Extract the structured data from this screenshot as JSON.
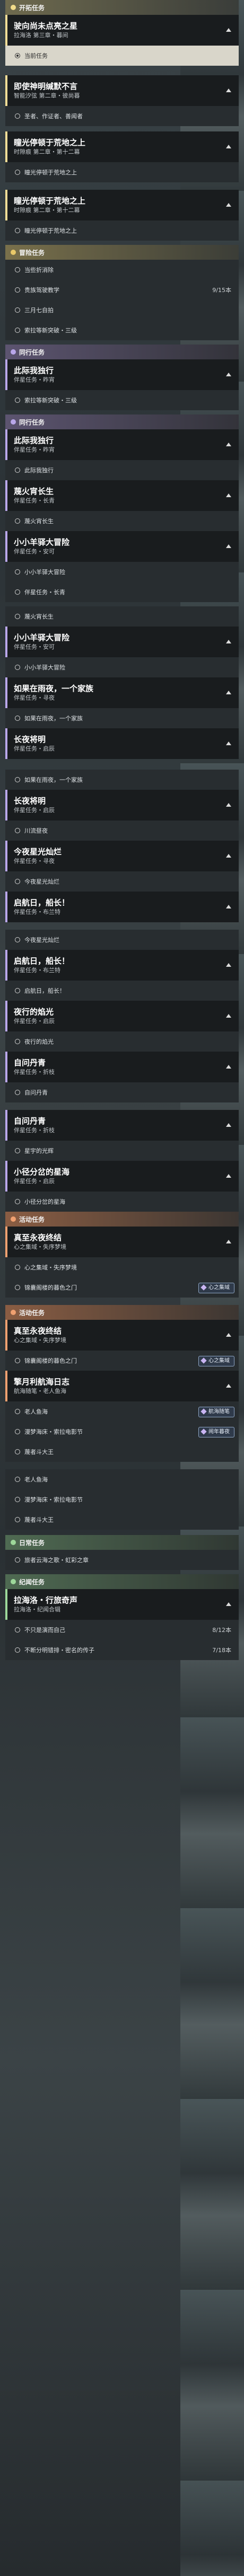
{
  "rows": [
    {
      "k": "hdr",
      "c": "main",
      "label": "开拓任务"
    },
    {
      "k": "card",
      "c": "main",
      "title": "驶向尚未点亮之星",
      "sub": "拉海洛 第三章・暮间"
    },
    {
      "k": "step",
      "label": "当前任务",
      "active": true
    },
    {
      "k": "gap",
      "h": 18
    },
    {
      "k": "card",
      "c": "main",
      "title": "即使神明缄默不言",
      "sub": "智能汐弦 第二章・彼尚暮"
    },
    {
      "k": "step",
      "label": "圣者、作证者、善闻者"
    },
    {
      "k": "gap",
      "h": 10
    },
    {
      "k": "card",
      "c": "main",
      "title": "瞳光停顿于荒地之上",
      "sub": "时隙痕 第二章・第十二幕"
    },
    {
      "k": "step",
      "label": "瞳光停顿于荒地之上"
    },
    {
      "k": "gap",
      "h": 14
    },
    {
      "k": "card",
      "c": "main",
      "title": "瞳光停顿于荒地之上",
      "sub": "时隙痕 第二章・第十二幕"
    },
    {
      "k": "step",
      "label": "瞳光停顿于荒地之上"
    },
    {
      "k": "gap",
      "h": 8
    },
    {
      "k": "hdr",
      "c": "side",
      "label": "冒险任务"
    },
    {
      "k": "step",
      "label": "当些折消除"
    },
    {
      "k": "step",
      "label": "贵族驾驶教学",
      "count": "9/15本"
    },
    {
      "k": "step",
      "label": "三月七自拍"
    },
    {
      "k": "step",
      "label": "索拉等新突破・三级"
    },
    {
      "k": "gap",
      "h": 8
    },
    {
      "k": "hdr",
      "c": "comp",
      "label": "同行任务"
    },
    {
      "k": "card",
      "c": "comp",
      "title": "此际我独行",
      "sub": "伴星任务・昨宵"
    },
    {
      "k": "step",
      "label": "索拉等新突破・三级"
    },
    {
      "k": "gap",
      "h": 8
    },
    {
      "k": "hdr",
      "c": "comp",
      "label": "同行任务"
    },
    {
      "k": "card",
      "c": "comp",
      "title": "此际我独行",
      "sub": "伴星任务・昨宵"
    },
    {
      "k": "step",
      "label": "此际我独行"
    },
    {
      "k": "card",
      "c": "comp",
      "title": "蔑火宵长生",
      "sub": "伴星任务・长青"
    },
    {
      "k": "step",
      "label": "蔑火宵长生"
    },
    {
      "k": "card",
      "c": "comp",
      "title": "小小羊驿大冒险",
      "sub": "伴星任务・安可"
    },
    {
      "k": "step",
      "label": "小小羊驿大冒险"
    },
    {
      "k": "step",
      "label": "伴星任务・长青"
    },
    {
      "k": "gap",
      "h": 8
    },
    {
      "k": "step",
      "label": "蔑火宵长生"
    },
    {
      "k": "card",
      "c": "comp",
      "title": "小小羊驿大冒险",
      "sub": "伴星任务・安可"
    },
    {
      "k": "step",
      "label": "小小羊驿大冒险"
    },
    {
      "k": "card",
      "c": "comp",
      "title": "如果在雨夜，一个家族",
      "sub": "伴星任务・寻夜"
    },
    {
      "k": "step",
      "label": "如果在雨夜，一个家族"
    },
    {
      "k": "card",
      "c": "comp",
      "title": "长夜将明",
      "sub": "伴星任务・启辰"
    },
    {
      "k": "gap",
      "h": 20
    },
    {
      "k": "step",
      "label": "如果在雨夜，一个家族"
    },
    {
      "k": "card",
      "c": "comp",
      "title": "长夜将明",
      "sub": "伴星任务・启辰"
    },
    {
      "k": "step",
      "label": "川流昼夜"
    },
    {
      "k": "card",
      "c": "comp",
      "title": "今夜星光灿烂",
      "sub": "伴星任务・寻夜"
    },
    {
      "k": "step",
      "label": "今夜星光灿烂"
    },
    {
      "k": "card",
      "c": "comp",
      "title": "启航日，船长！",
      "sub": "伴星任务・布兰特"
    },
    {
      "k": "gap",
      "h": 14
    },
    {
      "k": "step",
      "label": "今夜星光灿烂"
    },
    {
      "k": "card",
      "c": "comp",
      "title": "启航日，船长！",
      "sub": "伴星任务・布兰特"
    },
    {
      "k": "step",
      "label": "启航日，船长！"
    },
    {
      "k": "card",
      "c": "comp",
      "title": "夜行的焰光",
      "sub": "伴星任务・启辰"
    },
    {
      "k": "step",
      "label": "夜行的焰光"
    },
    {
      "k": "card",
      "c": "comp",
      "title": "自问丹青",
      "sub": "伴星任务・折枝"
    },
    {
      "k": "step",
      "label": "自问丹青"
    },
    {
      "k": "gap",
      "h": 14
    },
    {
      "k": "card",
      "c": "comp",
      "title": "自问丹青",
      "sub": "伴星任务・折枝"
    },
    {
      "k": "step",
      "label": "星宇的光辉"
    },
    {
      "k": "card",
      "c": "comp",
      "title": "小径分岔的星海",
      "sub": "伴星任务・启辰"
    },
    {
      "k": "step",
      "label": "小径分岔的星海"
    },
    {
      "k": "hdr",
      "c": "event",
      "label": "活动任务"
    },
    {
      "k": "card",
      "c": "event",
      "title": "真至永夜终结",
      "sub": "心之集域・失序梦境"
    },
    {
      "k": "step",
      "label": "心之集域・失序梦境"
    },
    {
      "k": "step",
      "label": "锦囊阁楼的暮色之门",
      "badge": "心之集域"
    },
    {
      "k": "gap",
      "h": 14
    },
    {
      "k": "hdr",
      "c": "event",
      "label": "活动任务"
    },
    {
      "k": "card",
      "c": "event",
      "title": "真至永夜终结",
      "sub": "心之集域・失序梦境"
    },
    {
      "k": "step",
      "label": "锦囊阁楼的暮色之门",
      "badge": "心之集域"
    },
    {
      "k": "card",
      "c": "event",
      "title": "擎月利航海日志",
      "sub": "航海随笔・老人鱼海"
    },
    {
      "k": "step",
      "label": "老人鱼海",
      "badge": "航海随笔"
    },
    {
      "k": "step",
      "label": "漫梦海床・索拉电影节",
      "badge": "闹年暮夜"
    },
    {
      "k": "step",
      "label": "蔑者斗大王"
    },
    {
      "k": "gap",
      "h": 14
    },
    {
      "k": "step",
      "label": "老人鱼海"
    },
    {
      "k": "step",
      "label": "漫梦海床・索拉电影节"
    },
    {
      "k": "step",
      "label": "蔑者斗大王"
    },
    {
      "k": "gap",
      "h": 10
    },
    {
      "k": "hdr",
      "c": "daily",
      "label": "日常任务"
    },
    {
      "k": "step",
      "label": "旅者云海之歌・虹彩之章"
    },
    {
      "k": "gap",
      "h": 8
    },
    {
      "k": "hdr",
      "c": "daily",
      "label": "纪闻任务"
    },
    {
      "k": "card",
      "c": "daily",
      "title": "拉海洛・行旅奇声",
      "sub": "拉海洛・纪闻合辑"
    },
    {
      "k": "step",
      "label": "不只是演而自己",
      "count": "8/12本"
    },
    {
      "k": "step",
      "label": "不断分明错排・密名的传子",
      "count": "7/18本"
    }
  ]
}
